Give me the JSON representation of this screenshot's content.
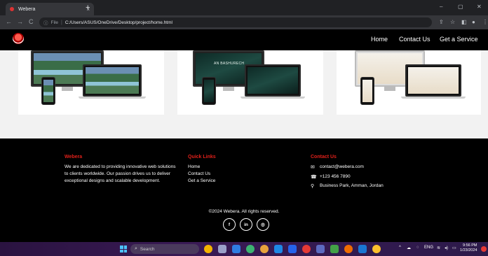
{
  "browser": {
    "tab_title": "Webera",
    "tab_close": "×",
    "new_tab": "+",
    "window_controls": [
      "–",
      "▢",
      "✕"
    ],
    "nav_back": "←",
    "nav_forward": "→",
    "nav_reload": "C",
    "address_prefix": "File",
    "address_url": "C:/Users/ASUS/OneDrive/Desktop/project/home.html"
  },
  "header": {
    "nav": [
      "Home",
      "Contact Us",
      "Get a Service"
    ]
  },
  "portfolio": {
    "card2_screen_text": "AN BASHURECH"
  },
  "footer": {
    "brand_title": "Webera",
    "about": [
      "We are dedicated to providing innovative web solutions",
      "to clients worldwide. Our passion drives us to deliver",
      "exceptional designs and scalable development."
    ],
    "quick_links_title": "Quick Links",
    "quick_links": [
      "Home",
      "Contact Us",
      "Get a Service"
    ],
    "contact_title": "Contact Us",
    "contact": {
      "email": "contact@webera.com",
      "phone": "+123 456 7890",
      "address": "Business Park, Amman, Jordan"
    },
    "copyright": "©2024 Webera. All rights reserved.",
    "social": [
      "f",
      "in",
      "◎"
    ]
  },
  "taskbar": {
    "search_placeholder": "Search",
    "lang": "ENG",
    "time": "9:56 PM",
    "date": "1/23/2024"
  },
  "colors": {
    "accent": "#e0201a",
    "page_bg": "#000000",
    "content_bg": "#f2f2f2"
  }
}
